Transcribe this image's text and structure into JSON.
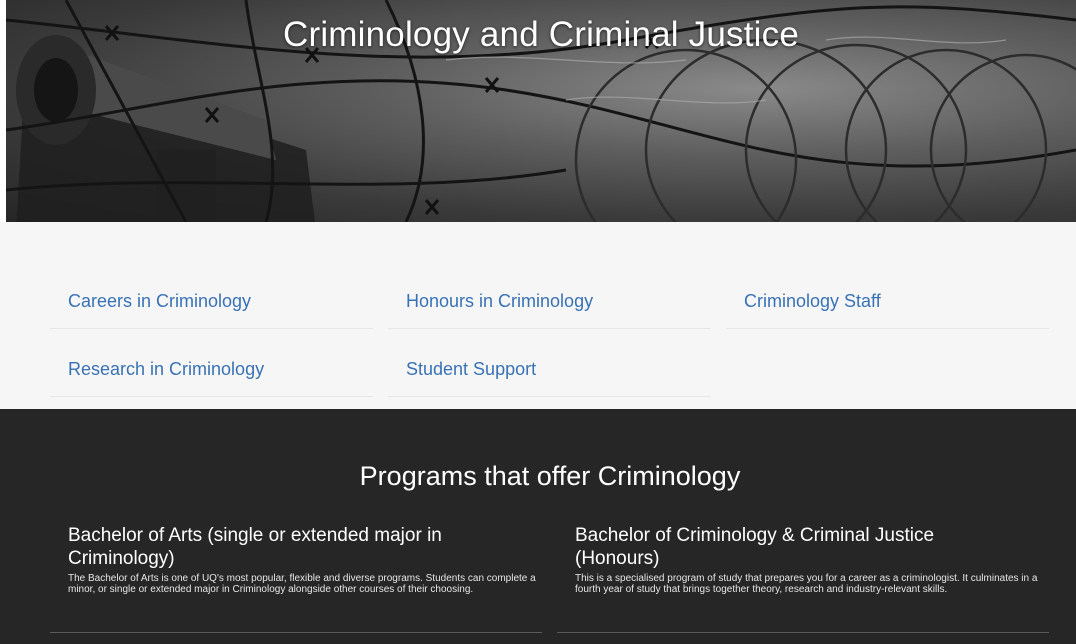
{
  "hero": {
    "title": "Criminology and Criminal Justice"
  },
  "quick_links": [
    {
      "label": "Careers in Criminology"
    },
    {
      "label": "Honours in Criminology"
    },
    {
      "label": "Criminology Staff"
    },
    {
      "label": "Research in Criminology"
    },
    {
      "label": "Student Support"
    }
  ],
  "programs": {
    "heading": "Programs that offer Criminology",
    "items": [
      {
        "title": "Bachelor of Arts (single or extended major in Criminology)",
        "description": "The Bachelor of Arts is one of UQ's most popular, flexible and diverse programs. Students can complete a minor, or single or extended major in Criminology alongside other courses of their choosing."
      },
      {
        "title": "Bachelor of Criminology & Criminal Justice (Honours)",
        "description": "This is a specialised program of study that prepares you for a career as a criminologist. It culminates in a fourth year of study that brings together theory, research and industry-relevant skills."
      }
    ]
  },
  "colors": {
    "link": "#3872b5",
    "links_background": "#f6f6f6",
    "programs_background": "#262626"
  }
}
